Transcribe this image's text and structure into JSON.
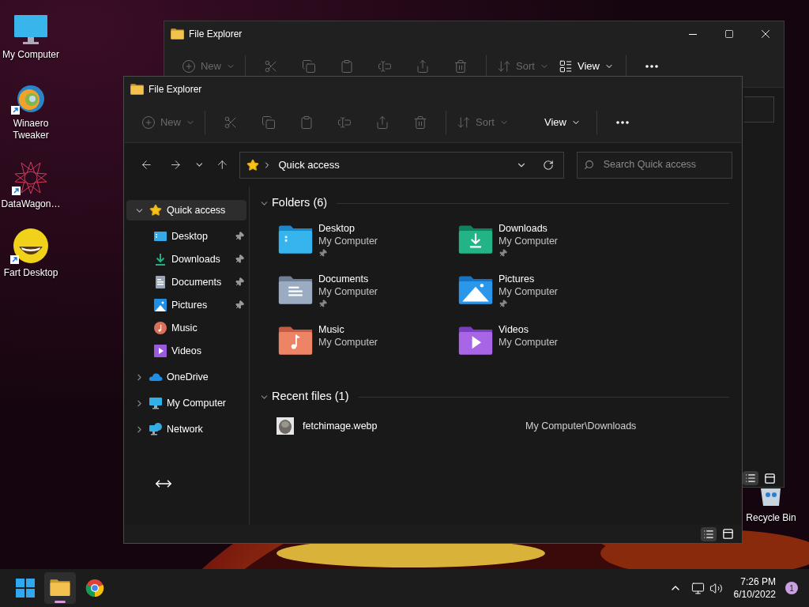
{
  "desktop_icons": [
    {
      "label": "My Computer",
      "kind": "computer",
      "shortcut": false
    },
    {
      "label": "Winaero Tweaker",
      "kind": "swirl",
      "shortcut": true
    },
    {
      "label": "DataWagon…",
      "kind": "star-pattern",
      "shortcut": true
    },
    {
      "label": "Fart Desktop",
      "kind": "smiley",
      "shortcut": true
    }
  ],
  "recycle_bin": {
    "label": "Recycle Bin"
  },
  "back_window": {
    "title": "File Explorer",
    "toolbar": [
      {
        "kind": "new",
        "label": "New",
        "disabled": true
      },
      {
        "kind": "separator"
      },
      {
        "kind": "cut",
        "disabled": true
      },
      {
        "kind": "copy",
        "disabled": true
      },
      {
        "kind": "paste",
        "disabled": true
      },
      {
        "kind": "rename",
        "disabled": true
      },
      {
        "kind": "share",
        "disabled": true
      },
      {
        "kind": "delete",
        "disabled": true
      },
      {
        "kind": "separator"
      },
      {
        "kind": "sort",
        "label": "Sort",
        "disabled": true
      },
      {
        "kind": "view",
        "label": "View",
        "disabled": false,
        "icon": true
      },
      {
        "kind": "separator"
      },
      {
        "kind": "more",
        "disabled": false
      }
    ]
  },
  "front_window": {
    "title": "File Explorer",
    "toolbar": [
      {
        "kind": "new",
        "label": "New",
        "disabled": true
      },
      {
        "kind": "separator"
      },
      {
        "kind": "cut",
        "disabled": true
      },
      {
        "kind": "copy",
        "disabled": true
      },
      {
        "kind": "paste",
        "disabled": true
      },
      {
        "kind": "rename",
        "disabled": true
      },
      {
        "kind": "share",
        "disabled": true
      },
      {
        "kind": "delete",
        "disabled": true
      },
      {
        "kind": "separator"
      },
      {
        "kind": "sort",
        "label": "Sort",
        "disabled": true
      },
      {
        "kind": "view",
        "label": "View",
        "disabled": false,
        "icon": false
      },
      {
        "kind": "separator"
      },
      {
        "kind": "more",
        "disabled": false
      }
    ],
    "address": {
      "path": "Quick access"
    },
    "search": {
      "placeholder": "Search Quick access"
    },
    "sidebar": [
      {
        "label": "Quick access",
        "kind": "star",
        "expanded": true,
        "selected": true,
        "children": [
          {
            "label": "Desktop",
            "kind": "desktop",
            "pinned": true,
            "selected": false
          },
          {
            "label": "Downloads",
            "kind": "downloads",
            "pinned": true,
            "selected": false
          },
          {
            "label": "Documents",
            "kind": "documents",
            "pinned": true,
            "selected": false
          },
          {
            "label": "Pictures",
            "kind": "pictures",
            "pinned": true,
            "selected": false
          },
          {
            "label": "Music",
            "kind": "music",
            "pinned": false,
            "selected": false
          },
          {
            "label": "Videos",
            "kind": "videos",
            "pinned": false,
            "selected": false
          }
        ]
      },
      {
        "label": "OneDrive",
        "kind": "onedrive",
        "expanded": false,
        "selected": false
      },
      {
        "label": "My Computer",
        "kind": "computer",
        "expanded": false,
        "selected": false
      },
      {
        "label": "Network",
        "kind": "network",
        "expanded": false,
        "selected": false
      }
    ],
    "folders": {
      "title": "Folders (6)",
      "expanded": true,
      "items": [
        {
          "name": "Desktop",
          "location": "My Computer",
          "kind": "desktop",
          "pinned": true
        },
        {
          "name": "Downloads",
          "location": "My Computer",
          "kind": "downloads",
          "pinned": true
        },
        {
          "name": "Documents",
          "location": "My Computer",
          "kind": "documents",
          "pinned": true
        },
        {
          "name": "Pictures",
          "location": "My Computer",
          "kind": "pictures",
          "pinned": true
        },
        {
          "name": "Music",
          "location": "My Computer",
          "kind": "music",
          "pinned": false
        },
        {
          "name": "Videos",
          "location": "My Computer",
          "kind": "videos",
          "pinned": false
        }
      ]
    },
    "recent": {
      "title": "Recent files (1)",
      "expanded": true,
      "items": [
        {
          "name": "fetchimage.webp",
          "location": "My Computer\\Downloads"
        }
      ]
    }
  },
  "taskbar": {
    "apps": [
      {
        "kind": "start",
        "active": false
      },
      {
        "kind": "explorer",
        "active": true
      },
      {
        "kind": "chrome",
        "active": false
      }
    ],
    "time": "7:26 PM",
    "date": "6/10/2022",
    "notifications": "1"
  }
}
